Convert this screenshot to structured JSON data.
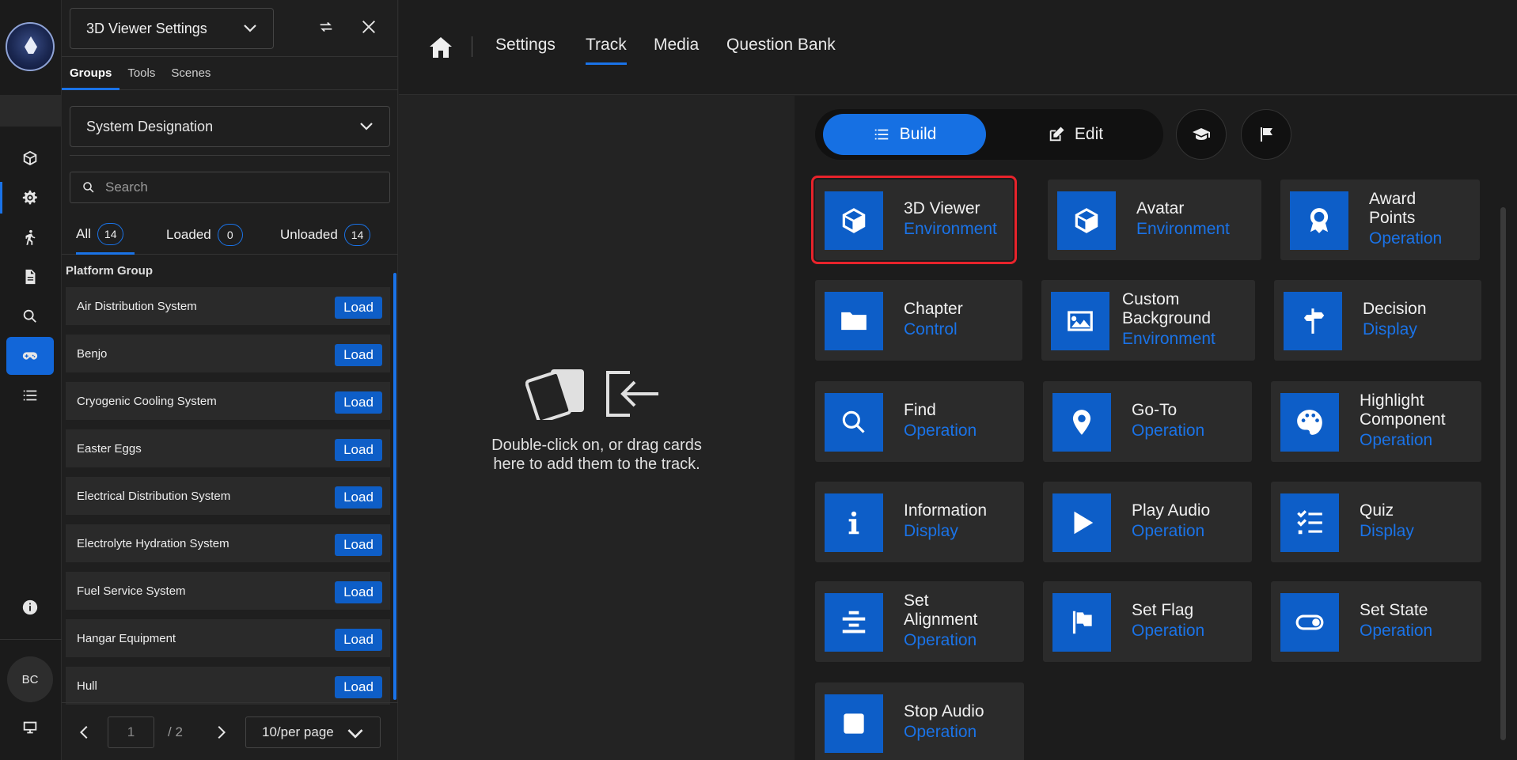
{
  "rail": {
    "avatar_initials": "BC",
    "icons": [
      "cube-icon",
      "gear-icon",
      "person-walk-icon",
      "document-icon",
      "search-icon",
      "gamepad-icon",
      "list-icon",
      "info-icon",
      "monitor-icon"
    ]
  },
  "panel": {
    "settings_select": "3D Viewer Settings",
    "tabs": [
      "Groups",
      "Tools",
      "Scenes"
    ],
    "system_select": "System Designation",
    "search_placeholder": "Search",
    "filters": [
      {
        "label": "All",
        "count": "14"
      },
      {
        "label": "Loaded",
        "count": "0"
      },
      {
        "label": "Unloaded",
        "count": "14"
      }
    ],
    "group_title": "Platform Group",
    "load_label": "Load",
    "items": [
      "Air Distribution System",
      "Benjo",
      "Cryogenic Cooling System",
      "Easter Eggs",
      "Electrical Distribution System",
      "Electrolyte Hydration System",
      "Fuel Service System",
      "Hangar Equipment",
      "Hull"
    ],
    "pager": {
      "page": "1",
      "total": "/ 2",
      "per_page": "10/per page"
    }
  },
  "nav": {
    "links": [
      "Settings",
      "Track",
      "Media",
      "Question Bank"
    ],
    "active": "Track"
  },
  "track": {
    "message": "Double-click on, or drag cards here to add them to the track."
  },
  "library": {
    "build_label": "Build",
    "edit_label": "Edit",
    "cards": [
      {
        "name": "3D Viewer",
        "type": "Environment",
        "icon": "cube-icon"
      },
      {
        "name": "Avatar",
        "type": "Environment",
        "icon": "cube-icon"
      },
      {
        "name": "Award Points",
        "type": "Operation",
        "icon": "award-icon"
      },
      {
        "name": "Chapter",
        "type": "Control",
        "icon": "folder-icon"
      },
      {
        "name": "Custom Background",
        "type": "Environment",
        "icon": "image-icon"
      },
      {
        "name": "Decision",
        "type": "Display",
        "icon": "signpost-icon"
      },
      {
        "name": "Find",
        "type": "Operation",
        "icon": "search-icon"
      },
      {
        "name": "Go-To",
        "type": "Operation",
        "icon": "location-pin-icon"
      },
      {
        "name": "Highlight Component",
        "type": "Operation",
        "icon": "palette-icon"
      },
      {
        "name": "Information",
        "type": "Display",
        "icon": "info-icon"
      },
      {
        "name": "Play Audio",
        "type": "Operation",
        "icon": "play-icon"
      },
      {
        "name": "Quiz",
        "type": "Display",
        "icon": "checklist-icon"
      },
      {
        "name": "Set Alignment",
        "type": "Operation",
        "icon": "align-center-icon"
      },
      {
        "name": "Set Flag",
        "type": "Operation",
        "icon": "flag-icon"
      },
      {
        "name": "Set State",
        "type": "Operation",
        "icon": "toggle-icon"
      },
      {
        "name": "Stop Audio",
        "type": "Operation",
        "icon": "stop-icon"
      }
    ],
    "selected_card": "3D Viewer"
  },
  "colors": {
    "accent": "#1a73e8",
    "card_icon_bg": "#0d5ec8",
    "selection_outline": "#e8232b"
  }
}
